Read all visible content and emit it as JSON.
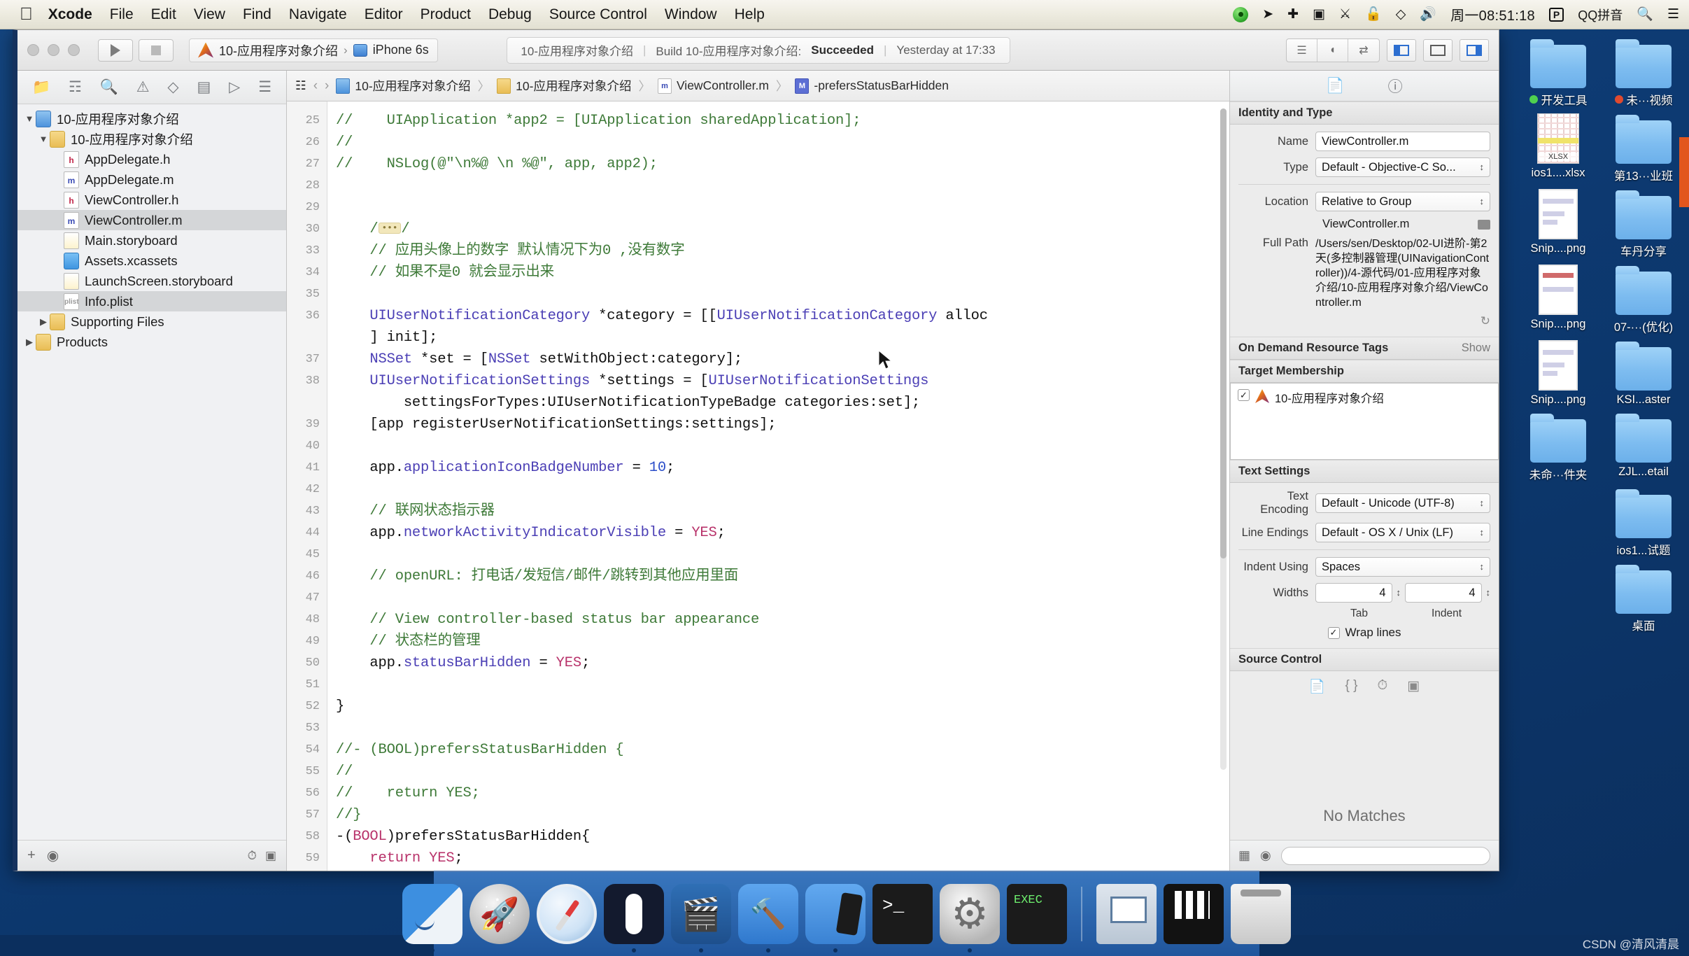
{
  "menubar": {
    "apple_icon": "apple-icon",
    "items": [
      {
        "label": "Xcode",
        "bold": true
      },
      {
        "label": "File",
        "bold": false
      },
      {
        "label": "Edit",
        "bold": false
      },
      {
        "label": "View",
        "bold": false
      },
      {
        "label": "Find",
        "bold": false
      },
      {
        "label": "Navigate",
        "bold": false
      },
      {
        "label": "Editor",
        "bold": false
      },
      {
        "label": "Product",
        "bold": false
      },
      {
        "label": "Debug",
        "bold": false
      },
      {
        "label": "Source Control",
        "bold": false
      },
      {
        "label": "Window",
        "bold": false
      },
      {
        "label": "Help",
        "bold": false
      }
    ],
    "status_icons": [
      "record-indicator-icon",
      "location-arrow-icon",
      "airdrop-icon",
      "screen-record-icon",
      "bluetooth-icon",
      "lock-icon",
      "wifi-icon",
      "volume-icon"
    ],
    "clock": "周一08:51:18",
    "input_badge": "P",
    "input_method": "QQ拼音",
    "search_icon": "search-icon",
    "notification_icon": "notification-center-icon"
  },
  "toolbar": {
    "run_label": "run-button",
    "stop_label": "stop-button",
    "scheme_name": "10-应用程序对象介绍",
    "scheme_chevron": "›",
    "destination": "iPhone 6s",
    "status": {
      "project": "10-应用程序对象介绍",
      "build_text": "Build 10-应用程序对象介绍:",
      "result": "Succeeded",
      "time": "Yesterday at 17:33",
      "sep": "|"
    }
  },
  "navigator": {
    "tabs": [
      "folder-icon",
      "source-control-icon",
      "search-icon",
      "warning-icon",
      "test-icon",
      "debug-icon",
      "breakpoint-icon",
      "report-icon"
    ],
    "tree": [
      {
        "label": "10-应用程序对象介绍",
        "indent": 0,
        "icon": "proj",
        "disclosure": "▼",
        "selected": false
      },
      {
        "label": "10-应用程序对象介绍",
        "indent": 1,
        "icon": "folder",
        "disclosure": "▼",
        "selected": false
      },
      {
        "label": "AppDelegate.h",
        "indent": 2,
        "icon": "h",
        "disclosure": "",
        "selected": false
      },
      {
        "label": "AppDelegate.m",
        "indent": 2,
        "icon": "m",
        "disclosure": "",
        "selected": false
      },
      {
        "label": "ViewController.h",
        "indent": 2,
        "icon": "h",
        "disclosure": "",
        "selected": false
      },
      {
        "label": "ViewController.m",
        "indent": 2,
        "icon": "m",
        "disclosure": "",
        "selected": true
      },
      {
        "label": "Main.storyboard",
        "indent": 2,
        "icon": "story",
        "disclosure": "",
        "selected": false
      },
      {
        "label": "Assets.xcassets",
        "indent": 2,
        "icon": "assets",
        "disclosure": "",
        "selected": false
      },
      {
        "label": "LaunchScreen.storyboard",
        "indent": 2,
        "icon": "story",
        "disclosure": "",
        "selected": false
      },
      {
        "label": "Info.plist",
        "indent": 2,
        "icon": "plain",
        "disclosure": "",
        "selected": true
      },
      {
        "label": "Supporting Files",
        "indent": 1,
        "icon": "folder",
        "disclosure": "▶",
        "selected": false
      },
      {
        "label": "Products",
        "indent": 0,
        "icon": "folder",
        "disclosure": "▶",
        "selected": false
      }
    ],
    "footer": {
      "add": "+",
      "filter": "filter-icon",
      "recent": "recent-icon",
      "unsaved": "unsaved-icon"
    }
  },
  "jumpbar": {
    "related_icon": "related-items-icon",
    "back": "‹",
    "forward": "›",
    "crumbs": [
      {
        "label": "10-应用程序对象介绍",
        "icon": "proj"
      },
      {
        "label": "10-应用程序对象介绍",
        "icon": "folder"
      },
      {
        "label": "ViewController.m",
        "icon": "m"
      },
      {
        "label": "-prefersStatusBarHidden",
        "icon": "mm"
      }
    ]
  },
  "code": {
    "first_line": 25,
    "lines": [
      {
        "n": "25",
        "html": "<span class='cm'>//    UIApplication *app2 = [UIApplication sharedApplication];</span>"
      },
      {
        "n": "26",
        "html": "<span class='cm'>//</span>"
      },
      {
        "n": "27",
        "html": "<span class='cm'>//    NSLog(@\"\\n%@ \\n %@\", app, app2);</span>"
      },
      {
        "n": "28",
        "html": ""
      },
      {
        "n": "29",
        "html": ""
      },
      {
        "n": "30",
        "html": "    <span class='cm'>/</span><span class='foldmark'>•••</span><span class='cm'>/</span>"
      },
      {
        "n": "33",
        "html": "    <span class='cm'>// 应用头像上的数字 默认情况下为0 ,没有数字</span>"
      },
      {
        "n": "34",
        "html": "    <span class='cm'>// 如果不是0 就会显示出来</span>"
      },
      {
        "n": "35",
        "html": ""
      },
      {
        "n": "36",
        "html": "    <span class='ty'>UIUserNotificationCategory</span> *category = [[<span class='ty'>UIUserNotificationCategory</span> alloc\n    ] init];"
      },
      {
        "n": "37",
        "html": "    <span class='ty'>NSSet</span> *set = [<span class='ty'>NSSet</span> setWithObject:category];"
      },
      {
        "n": "38",
        "html": "    <span class='ty'>UIUserNotificationSettings</span> *settings = [<span class='ty'>UIUserNotificationSettings</span>\n        settingsForTypes:UIUserNotificationTypeBadge categories:set];"
      },
      {
        "n": "39",
        "html": "    [app registerUserNotificationSettings:settings];"
      },
      {
        "n": "40",
        "html": ""
      },
      {
        "n": "41",
        "html": "    app.<span class='ty'>applicationIconBadgeNumber</span> = <span class='num'>10</span>;"
      },
      {
        "n": "42",
        "html": ""
      },
      {
        "n": "43",
        "html": "    <span class='cm'>// 联网状态指示器</span>"
      },
      {
        "n": "44",
        "html": "    app.<span class='ty'>networkActivityIndicatorVisible</span> = <span class='kw'>YES</span>;"
      },
      {
        "n": "45",
        "html": ""
      },
      {
        "n": "46",
        "html": "    <span class='cm'>// openURL: 打电话/发短信/邮件/跳转到其他应用里面</span>"
      },
      {
        "n": "47",
        "html": ""
      },
      {
        "n": "48",
        "html": "    <span class='cm'>// View controller-based status bar appearance</span>"
      },
      {
        "n": "49",
        "html": "    <span class='cm'>// 状态栏的管理</span>"
      },
      {
        "n": "50",
        "html": "    app.<span class='ty'>statusBarHidden</span> = <span class='kw'>YES</span>;"
      },
      {
        "n": "51",
        "html": ""
      },
      {
        "n": "52",
        "html": "}"
      },
      {
        "n": "53",
        "html": ""
      },
      {
        "n": "54",
        "html": "<span class='cm'>//- (BOOL)prefersStatusBarHidden {</span>"
      },
      {
        "n": "55",
        "html": "<span class='cm'>//</span>"
      },
      {
        "n": "56",
        "html": "<span class='cm'>//    return YES;</span>"
      },
      {
        "n": "57",
        "html": "<span class='cm'>//}</span>"
      },
      {
        "n": "58",
        "html": "-(<span class='kw'>BOOL</span>)prefersStatusBarHidden{"
      },
      {
        "n": "59",
        "html": "    <span class='kw'>return</span> <span class='kw'>YES</span>;"
      }
    ]
  },
  "inspector": {
    "tabs": [
      "file-inspector-icon",
      "quick-help-icon"
    ],
    "identity": {
      "header": "Identity and Type",
      "name_label": "Name",
      "name_value": "ViewController.m",
      "type_label": "Type",
      "type_value": "Default - Objective-C So...",
      "location_label": "Location",
      "location_value": "Relative to Group",
      "file_name": "ViewController.m",
      "fullpath_label": "Full Path",
      "fullpath_value": "/Users/sen/Desktop/02-UI进阶-第2天(多控制器管理(UINavigationController))/4-源代码/01-应用程序对象介绍/10-应用程序对象介绍/ViewController.m"
    },
    "ondemand": {
      "header": "On Demand Resource Tags",
      "show": "Show"
    },
    "target": {
      "header": "Target Membership",
      "item": "10-应用程序对象介绍",
      "checked": "✓"
    },
    "text_settings": {
      "header": "Text Settings",
      "encoding_label": "Text Encoding",
      "encoding_value": "Default - Unicode (UTF-8)",
      "endings_label": "Line Endings",
      "endings_value": "Default - OS X / Unix (LF)",
      "indent_label": "Indent Using",
      "indent_value": "Spaces",
      "widths_label": "Widths",
      "tab_width": "4",
      "indent_width": "4",
      "tab_caption": "Tab",
      "indent_caption": "Indent",
      "wrap_label": "Wrap lines",
      "wrap_checked": "✓"
    },
    "source_control": {
      "header": "Source Control",
      "no_matches": "No Matches"
    }
  },
  "desktop": {
    "icons": [
      {
        "name": "开发工具",
        "type": "folder",
        "tag": "green"
      },
      {
        "name": "未···视频",
        "type": "folder",
        "tag": "red"
      },
      {
        "name": "ios1....xlsx",
        "type": "xlsx",
        "tag": ""
      },
      {
        "name": "第13···业班",
        "type": "folder",
        "tag": ""
      },
      {
        "name": "Snip....png",
        "type": "png",
        "tag": ""
      },
      {
        "name": "车丹分享",
        "type": "folder",
        "tag": ""
      },
      {
        "name": "Snip....png",
        "type": "png2",
        "tag": ""
      },
      {
        "name": "07-···(优化)",
        "type": "folder",
        "tag": ""
      },
      {
        "name": "Snip....png",
        "type": "png3",
        "tag": ""
      },
      {
        "name": "KSI...aster",
        "type": "folder",
        "tag": ""
      },
      {
        "name": "未命···件夹",
        "type": "folder",
        "tag": ""
      },
      {
        "name": "ZJL...etail",
        "type": "folder",
        "tag": ""
      },
      {
        "name": "",
        "type": "spacer",
        "tag": ""
      },
      {
        "name": "ios1...试题",
        "type": "folder",
        "tag": ""
      },
      {
        "name": "",
        "type": "spacer",
        "tag": ""
      },
      {
        "name": "桌面",
        "type": "folder",
        "tag": ""
      }
    ]
  },
  "dock": {
    "items": [
      {
        "name": "finder",
        "cls": "dk-finder",
        "running": true
      },
      {
        "name": "launchpad",
        "cls": "dk-launch",
        "running": false
      },
      {
        "name": "safari",
        "cls": "dk-safari",
        "running": false
      },
      {
        "name": "mouse-app",
        "cls": "dk-mouse",
        "running": true
      },
      {
        "name": "imovie",
        "cls": "dk-imovie",
        "running": true
      },
      {
        "name": "xcode",
        "cls": "dk-xcode",
        "running": true
      },
      {
        "name": "xcode-beta",
        "cls": "dk-xcode2",
        "running": true
      },
      {
        "name": "terminal",
        "cls": "dk-term",
        "running": false
      },
      {
        "name": "system-preferences",
        "cls": "dk-sys",
        "running": true
      },
      {
        "name": "exec-app",
        "cls": "dk-exec",
        "running": false
      },
      {
        "name": "separator",
        "cls": "sep",
        "running": false
      },
      {
        "name": "screen-sharing",
        "cls": "dk-screens",
        "running": false
      },
      {
        "name": "calculator",
        "cls": "dk-calc",
        "running": false
      },
      {
        "name": "trash",
        "cls": "dk-trash",
        "running": false
      }
    ]
  },
  "watermark": "CSDN @清风清晨"
}
